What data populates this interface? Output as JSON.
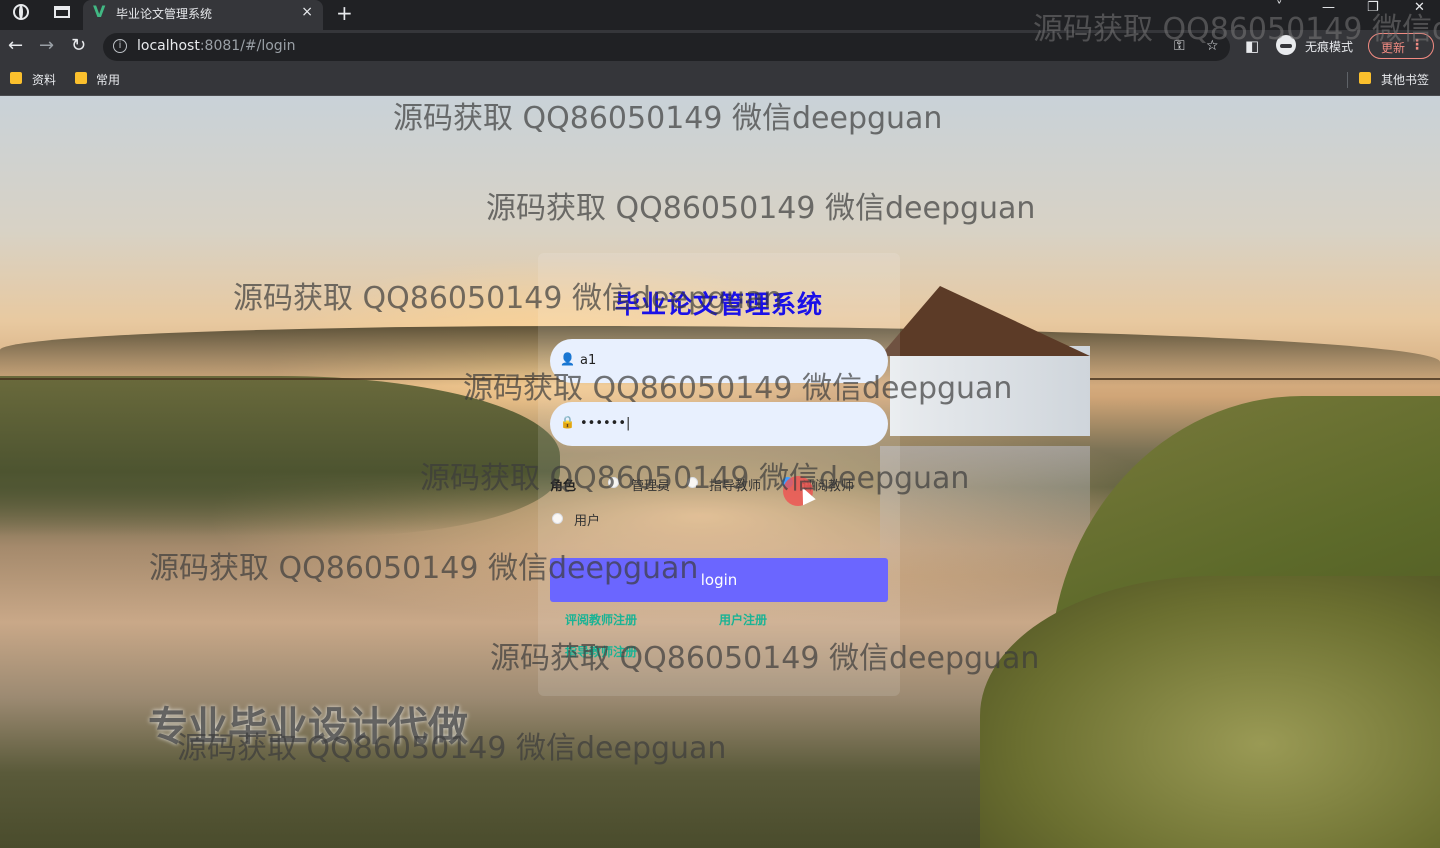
{
  "browser": {
    "tab_title": "毕业论文管理系统",
    "tab_close": "×",
    "new_tab": "+",
    "url_host": "localhost",
    "url_rest": ":8081/#/login",
    "incognito_label": "无痕模式",
    "update_label": "更新",
    "update_menu": "⋮",
    "bookmarks": [
      "资料",
      "常用"
    ],
    "other_bookmarks": "其他书签",
    "window_controls": [
      "˅",
      "—",
      "❐",
      "✕"
    ]
  },
  "login": {
    "title": "毕业论文管理系统",
    "username_icon": "person-icon",
    "username_value": "a1",
    "password_icon": "lock-icon",
    "password_value": "••••••|",
    "role_label": "角色",
    "roles": [
      "管理员",
      "指导教师",
      "评阅教师",
      "用户"
    ],
    "selected_role": "评阅教师",
    "login_button": "login",
    "links": [
      "评阅教师注册",
      "用户注册",
      "指导教师注册"
    ]
  },
  "watermark_text": "源码获取 QQ86050149 微信deepguan",
  "ad_text": "专业毕业设计代做",
  "colors": {
    "title": "#1a10e8",
    "button": "#6b66ff",
    "links": "#1ab394",
    "input_bg": "#e8f0fe"
  }
}
